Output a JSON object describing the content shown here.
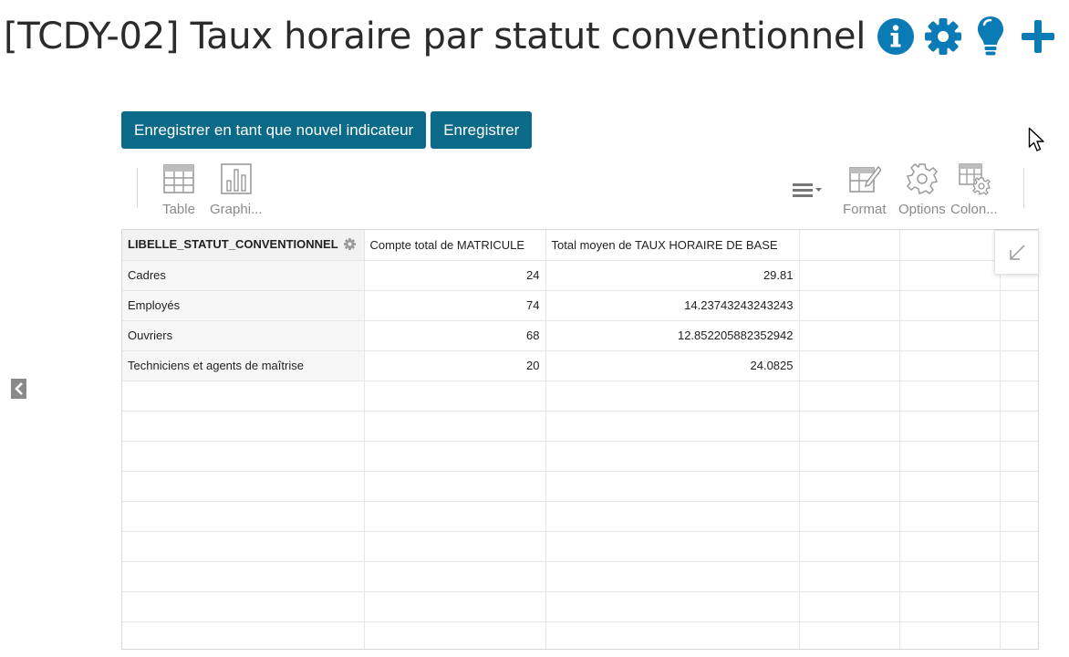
{
  "header": {
    "title": "[TCDY-02] Taux horaire par statut conventionnel",
    "icons": [
      "info-icon",
      "gear-icon",
      "lightbulb-icon",
      "plus-icon"
    ],
    "accent_color": "#0a7bb5"
  },
  "actions": {
    "save_new_label": "Enregistrer en tant que nouvel indicateur",
    "save_label": "Enregistrer",
    "button_color": "#0a6a87"
  },
  "toolbar": {
    "table_label": "Table",
    "chart_label": "Graphi...",
    "format_label": "Format",
    "options_label": "Options",
    "columns_label": "Colon..."
  },
  "grid": {
    "columns": [
      "LIBELLE_STATUT_CONVENTIONNEL",
      "Compte total de MATRICULE",
      "Total moyen de TAUX HORAIRE DE BASE"
    ],
    "rows": [
      {
        "label": "Cadres",
        "count": "24",
        "avg": "29.81"
      },
      {
        "label": "Employés",
        "count": "74",
        "avg": "14.23743243243243"
      },
      {
        "label": "Ouvriers",
        "count": "68",
        "avg": "12.852205882352942"
      },
      {
        "label": "Techniciens et agents de maîtrise",
        "count": "20",
        "avg": "24.0825"
      }
    ]
  }
}
